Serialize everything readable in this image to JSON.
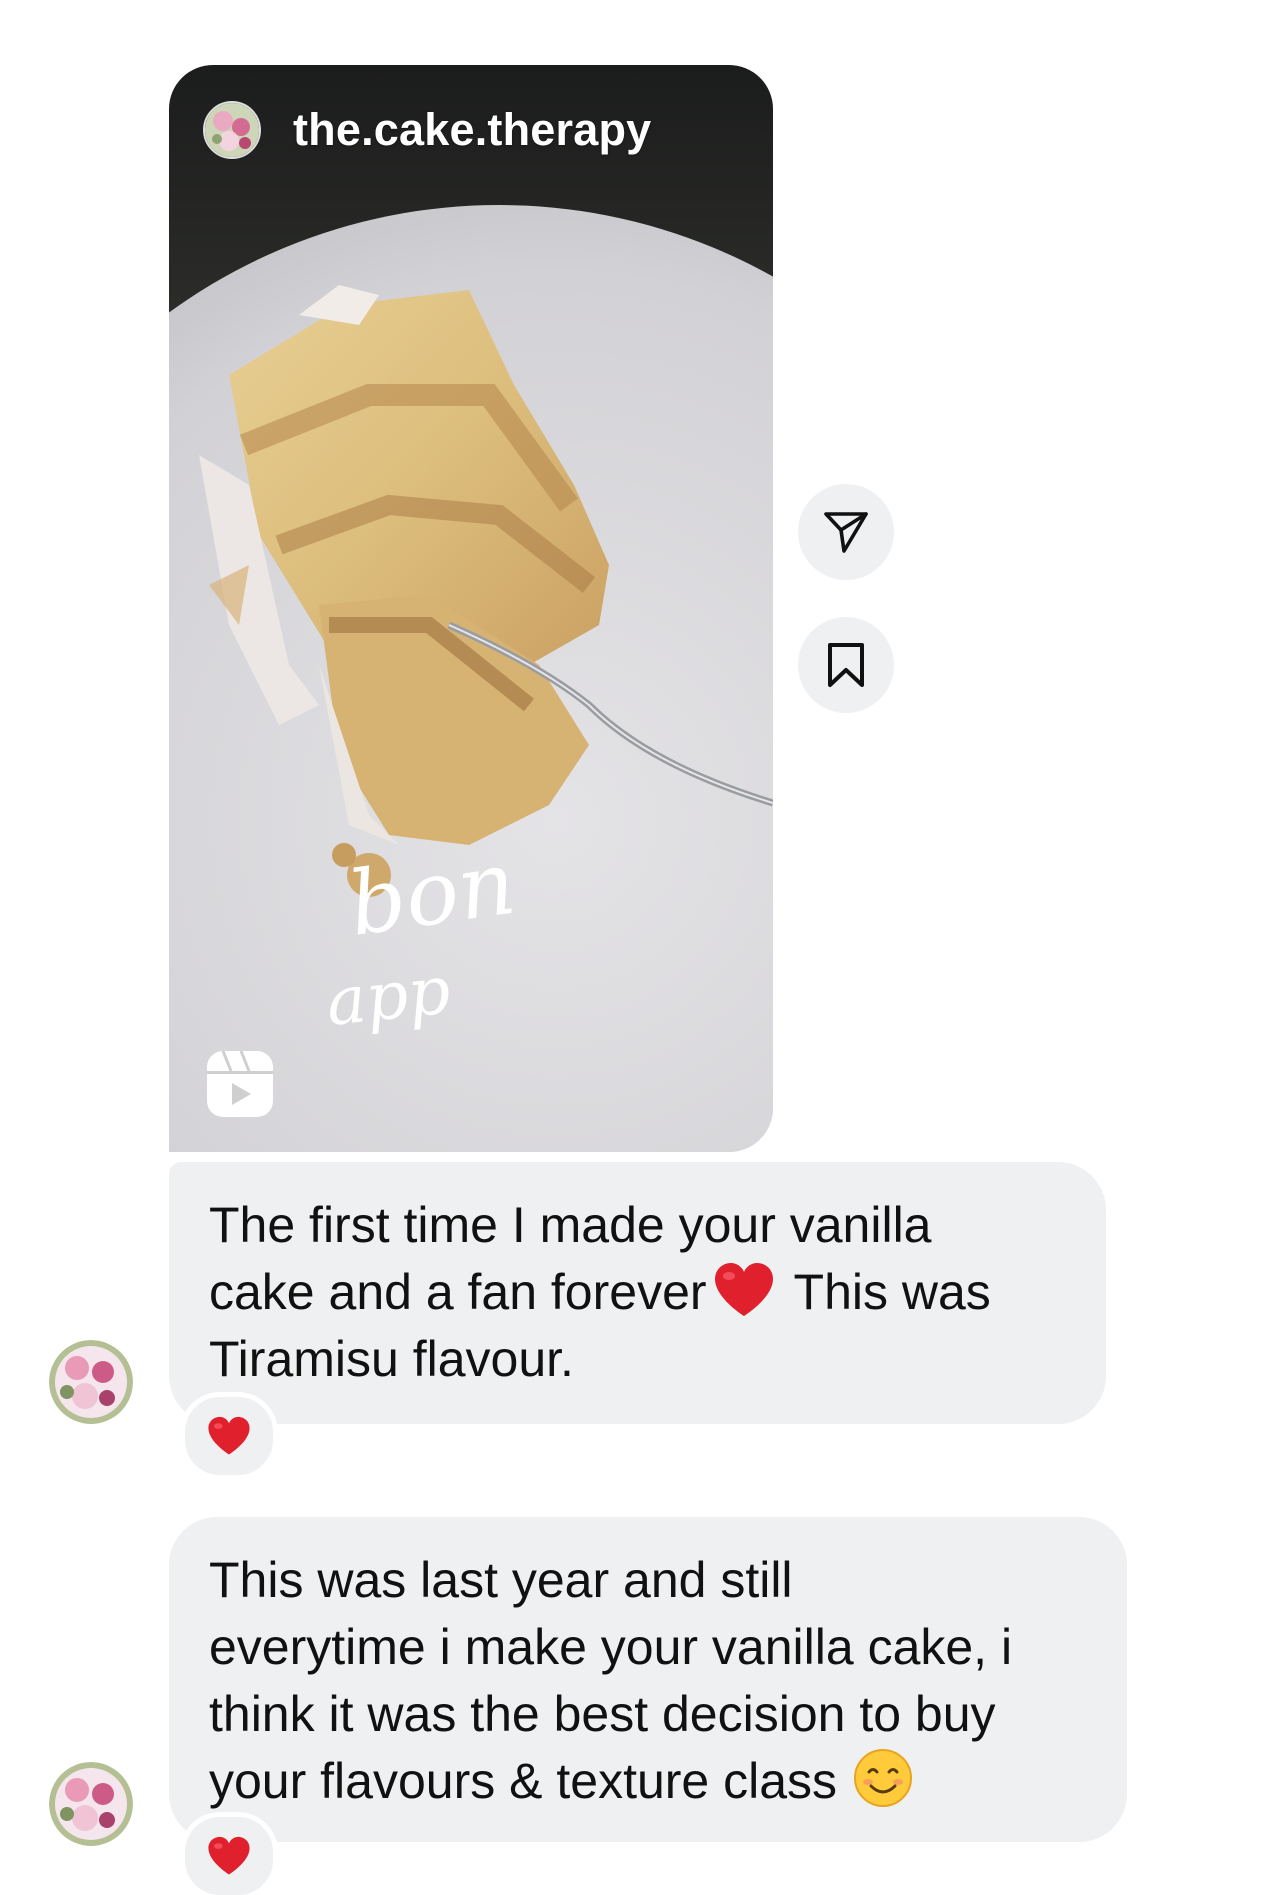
{
  "reel": {
    "username": "the.cake.therapy",
    "overlay_script_text": "bon app",
    "media_type_icon": "reels-icon"
  },
  "actions": {
    "share_icon": "send-icon",
    "save_icon": "bookmark-icon"
  },
  "messages": [
    {
      "text_before_emoji": "The first time I made your vanilla\ncake and a fan forever",
      "inline_emoji": "red-heart",
      "text_after_emoji": " This was\nTiramisu flavour.",
      "reaction": "red-heart"
    },
    {
      "text_before_emoji": "This was last year and still\neverytime i make your vanilla cake, i\nthink it was the best decision to buy\nyour flavours & texture class",
      "inline_emoji": "smiling-face",
      "text_after_emoji": "",
      "reaction": "red-heart"
    }
  ],
  "colors": {
    "bubble_background": "#eff0f2",
    "text": "#111111",
    "heart": "#e0202d",
    "page_background": "#ffffff"
  }
}
